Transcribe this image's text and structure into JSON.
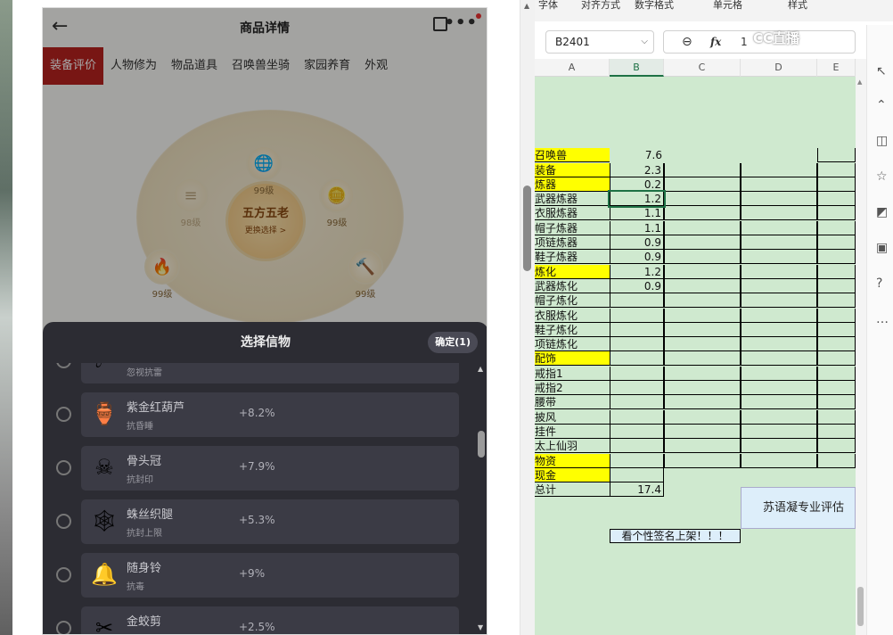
{
  "app": {
    "title": "商品详情",
    "back_icon": "←",
    "tabs": [
      "装备评价",
      "人物修为",
      "物品道具",
      "召唤兽坐骑",
      "家园养育",
      "外观"
    ],
    "active_tab": 0
  },
  "wheel": {
    "center_title": "五方五老",
    "center_sub": "更换选择 >",
    "nodes": [
      {
        "icon": "globe-gem",
        "level": "99级"
      },
      {
        "icon": "gold-ingot",
        "level": "99级"
      },
      {
        "icon": "blue-hammer",
        "level": "99级"
      },
      {
        "icon": "orange-orb",
        "level": "99级"
      },
      {
        "icon": "faded-slot",
        "level": "98级"
      }
    ]
  },
  "sheet": {
    "title": "选择信物",
    "confirm": "确定(1)",
    "items": [
      {
        "name": "",
        "effect": "忽视抗雷",
        "bonus": "+2.8%",
        "icon": "☄"
      },
      {
        "name": "紫金红葫芦",
        "effect": "抗昏睡",
        "bonus": "+8.2%",
        "icon": "🏺"
      },
      {
        "name": "骨头冠",
        "effect": "抗封印",
        "bonus": "+7.9%",
        "icon": "☠"
      },
      {
        "name": "蛛丝织腿",
        "effect": "抗封上限",
        "bonus": "+5.3%",
        "icon": "🕸"
      },
      {
        "name": "随身铃",
        "effect": "抗毒",
        "bonus": "+9%",
        "icon": "🔔"
      },
      {
        "name": "金蛟剪",
        "effect": "",
        "bonus": "+2.5%",
        "icon": "✂"
      }
    ]
  },
  "spreadsheet": {
    "ribbon": [
      "字体",
      "对齐方式",
      "数字格式",
      "单元格",
      "样式"
    ],
    "name_box": "B2401",
    "formula_value": "1",
    "watermark": "CC直播",
    "columns": [
      "A",
      "B",
      "C",
      "D",
      "E"
    ],
    "rows": [
      {
        "a": "",
        "b": ""
      },
      {
        "a": "",
        "b": ""
      },
      {
        "a": "",
        "b": ""
      },
      {
        "a": "",
        "b": ""
      },
      {
        "a": "召唤兽",
        "b": "7.6",
        "yellow": true
      },
      {
        "a": "装备",
        "b": "2.3",
        "yellow": true
      },
      {
        "a": "炼器",
        "b": "0.2",
        "yellow": true
      },
      {
        "a": "武器炼器",
        "b": "1.2",
        "selected": true
      },
      {
        "a": "衣服炼器",
        "b": "1.1"
      },
      {
        "a": "帽子炼器",
        "b": "1.1"
      },
      {
        "a": "项链炼器",
        "b": "0.9"
      },
      {
        "a": "鞋子炼器",
        "b": "0.9"
      },
      {
        "a": "炼化",
        "b": "1.2",
        "yellow": true
      },
      {
        "a": "武器炼化",
        "b": "0.9"
      },
      {
        "a": "帽子炼化",
        "b": ""
      },
      {
        "a": "衣服炼化",
        "b": ""
      },
      {
        "a": "鞋子炼化",
        "b": ""
      },
      {
        "a": "项链炼化",
        "b": ""
      },
      {
        "a": "配饰",
        "b": "",
        "yellow": true
      },
      {
        "a": "戒指1",
        "b": ""
      },
      {
        "a": "戒指2",
        "b": ""
      },
      {
        "a": "腰带",
        "b": ""
      },
      {
        "a": "披风",
        "b": ""
      },
      {
        "a": "挂件",
        "b": ""
      },
      {
        "a": "太上仙羽",
        "b": ""
      },
      {
        "a": "物资",
        "b": "",
        "yellow": true
      },
      {
        "a": "现金",
        "b": "",
        "yellow": true
      },
      {
        "a": "总计",
        "b": "17.4"
      }
    ],
    "eval_note": "苏语凝专业评估",
    "signature": "看个性签名上架！！！"
  },
  "colors": {
    "active_tab": "#b8231f",
    "cell_green": "#cfe9cf",
    "yellow": "#ffff00"
  }
}
